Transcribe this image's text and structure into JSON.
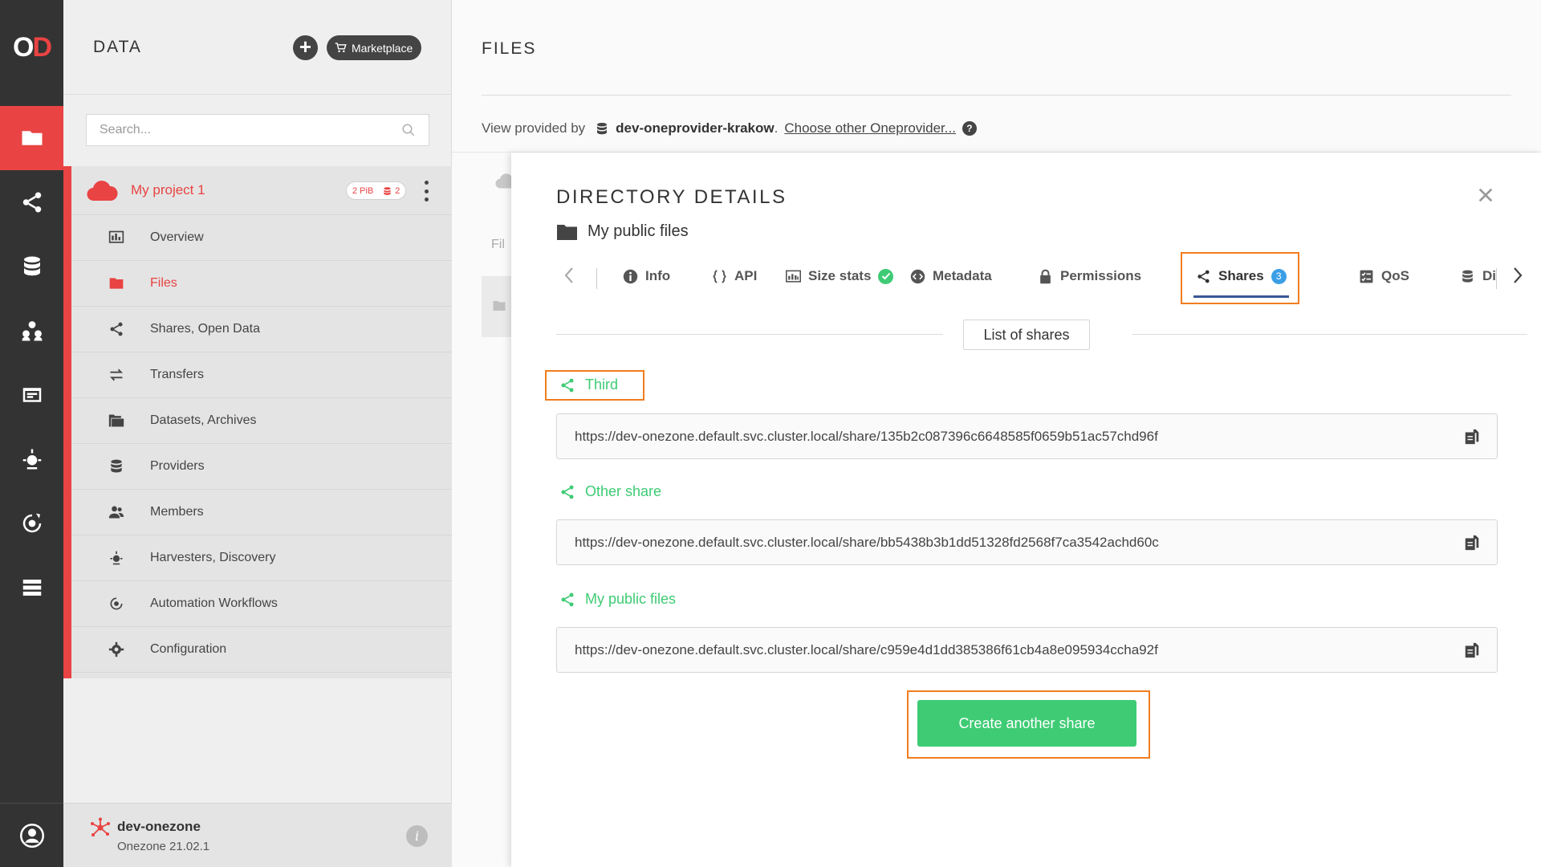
{
  "rail": {
    "logo_main": "O",
    "logo_accent": "D",
    "items": [
      {
        "icon": "folder-icon",
        "active": true
      },
      {
        "icon": "share-icon",
        "active": false
      },
      {
        "icon": "database-icon",
        "active": false
      },
      {
        "icon": "groups-icon",
        "active": false
      },
      {
        "icon": "tokens-icon",
        "active": false
      },
      {
        "icon": "harvester-icon",
        "active": false
      },
      {
        "icon": "automation-icon",
        "active": false
      },
      {
        "icon": "clusters-icon",
        "active": false
      }
    ],
    "bottom_icon": "user-icon"
  },
  "sidebar": {
    "title": "DATA",
    "add_icon": "plus-icon",
    "marketplace_label": "Marketplace",
    "search_placeholder": "Search...",
    "space": {
      "name": "My project 1",
      "size": "2 PiB",
      "providers_count": "2",
      "accent": "#e94343"
    },
    "nav": [
      {
        "label": "Overview",
        "icon": "overview-icon",
        "active": false
      },
      {
        "label": "Files",
        "icon": "folder-icon",
        "active": true
      },
      {
        "label": "Shares, Open Data",
        "icon": "share-icon",
        "active": false
      },
      {
        "label": "Transfers",
        "icon": "transfer-icon",
        "active": false
      },
      {
        "label": "Datasets, Archives",
        "icon": "datasets-icon",
        "active": false
      },
      {
        "label": "Providers",
        "icon": "database-icon",
        "active": false
      },
      {
        "label": "Members",
        "icon": "members-icon",
        "active": false
      },
      {
        "label": "Harvesters, Discovery",
        "icon": "harvester-icon",
        "active": false
      },
      {
        "label": "Automation Workflows",
        "icon": "automation-icon",
        "active": false
      },
      {
        "label": "Configuration",
        "icon": "gear-icon",
        "active": false
      }
    ],
    "footer": {
      "zone_name": "dev-onezone",
      "zone_version": "Onezone 21.02.1"
    }
  },
  "main": {
    "title": "FILES",
    "provider_prefix": "View provided by",
    "provider_name": "dev-oneprovider-krakow",
    "provider_link": "Choose other Oneprovider...",
    "help_symbol": "?",
    "browser_header_fragment": "Fil"
  },
  "modal": {
    "title": "DIRECTORY DETAILS",
    "directory_name": "My public files",
    "tabs": [
      {
        "label": "Info",
        "icon": "info-icon"
      },
      {
        "label": "API",
        "icon": "api-icon"
      },
      {
        "label": "Size stats",
        "icon": "size-stats-icon",
        "status": "ok"
      },
      {
        "label": "Metadata",
        "icon": "metadata-icon"
      },
      {
        "label": "Permissions",
        "icon": "lock-icon"
      },
      {
        "label": "Shares",
        "icon": "share-icon",
        "count": "3",
        "active": true
      },
      {
        "label": "QoS",
        "icon": "qos-icon"
      },
      {
        "label": "Di",
        "icon": "distribution-icon"
      }
    ],
    "list_header": "List of shares",
    "shares": [
      {
        "name": "Third",
        "url": "https://dev-onezone.default.svc.cluster.local/share/135b2c087396c6648585f0659b51ac57chd96f"
      },
      {
        "name": "Other share",
        "url": "https://dev-onezone.default.svc.cluster.local/share/bb5438b3b1dd51328fd2568f7ca3542achd60c"
      },
      {
        "name": "My public files",
        "url": "https://dev-onezone.default.svc.cluster.local/share/c959e4d1dd385386f61cb4a8e095934ccha92f"
      }
    ],
    "create_button": "Create another share",
    "colors": {
      "green": "#3ecb74",
      "highlight": "#f07d1e",
      "count_badge": "#3b9fe6"
    }
  }
}
